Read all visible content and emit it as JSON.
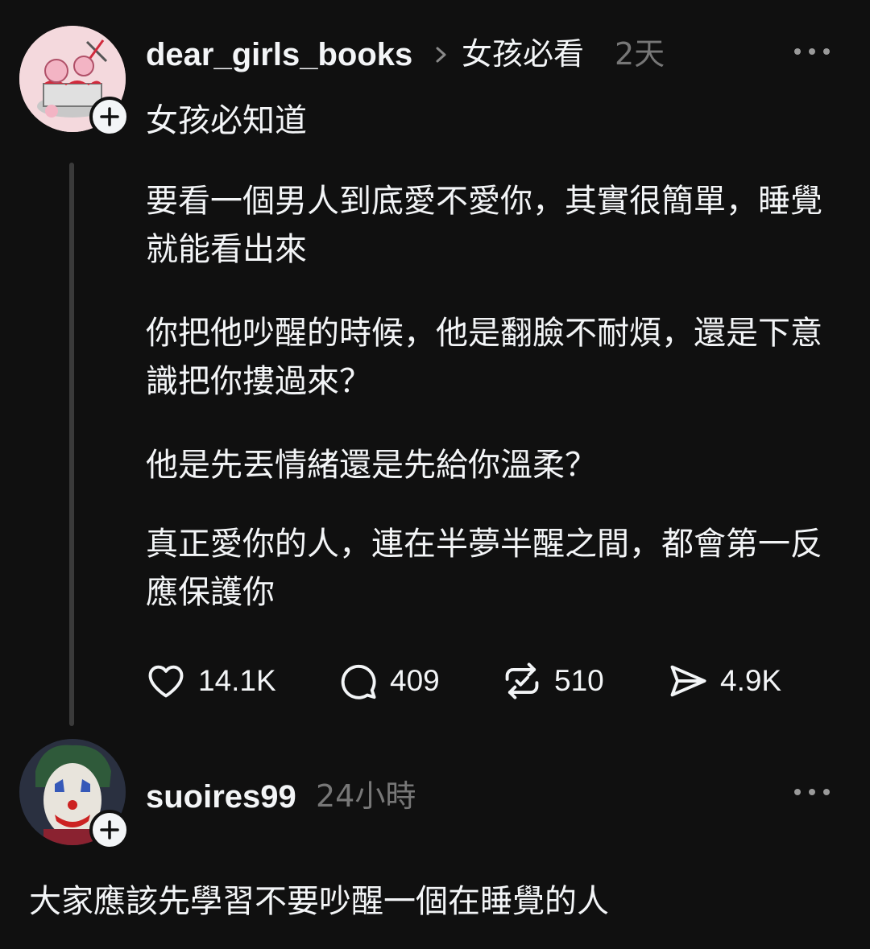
{
  "post": {
    "username": "dear_girls_books",
    "topic": "女孩必看",
    "time": "2天",
    "subtitle": "女孩必知道",
    "paragraphs": [
      "要看一個男人到底愛不愛你，其實很簡單，睡覺就能看出來",
      "你把他吵醒的時候，他是翻臉不耐煩，還是下意識把你摟過來？",
      "他是先丟情緒還是先給你溫柔？",
      "真正愛你的人，連在半夢半醒之間，都會第一反應保護你"
    ],
    "stats": {
      "likes": "14.1K",
      "replies": "409",
      "reposts": "510",
      "shares": "4.9K"
    },
    "icons": {
      "avatar": "cake-illustration-avatar",
      "follow": "plus-icon",
      "more": "more-icon",
      "topic_separator": "chevron-right-icon",
      "like": "heart-icon",
      "reply": "comment-icon",
      "repost": "repost-icon",
      "share": "send-icon"
    }
  },
  "reply": {
    "username": "suoires99",
    "time": "24小時",
    "text": "大家應該先學習不要吵醒一個在睡覺的人",
    "icons": {
      "avatar": "joker-face-avatar",
      "follow": "plus-icon",
      "more": "more-icon"
    }
  },
  "colors": {
    "background": "#101010",
    "text": "#f3f5f7",
    "muted": "#777777",
    "thread_line": "#3a3a3a"
  }
}
